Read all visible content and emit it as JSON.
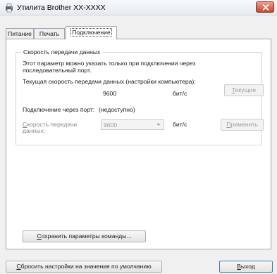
{
  "window": {
    "title": "Утилита Brother XX-XXXX"
  },
  "tabs": [
    {
      "label": "Питание"
    },
    {
      "label": "Печать"
    },
    {
      "label": "Подключение"
    }
  ],
  "connection": {
    "group_title": "Скорость передачи данных",
    "description_line1": "Этот параметр можно указать только при подключении через",
    "description_line2": "последовательный порт.",
    "current_speed_label": "Текущая скорость передачи данных (настройки компьютера):",
    "current_speed_value": "9600",
    "current_speed_unit": "бит/с",
    "current_button": {
      "first": "Т",
      "rest": "екущие"
    },
    "port_label": "Подключение через порт:",
    "port_value": "(недоступно)",
    "speed_label_first": "С",
    "speed_label_rest": "корость передачи",
    "speed_label_line2": "данных:",
    "speed_select_value": "9600",
    "speed_unit": "бит/с",
    "apply_button": {
      "first": "П",
      "rest": "рименить"
    }
  },
  "save_button": {
    "first": "С",
    "rest": "охранить параметры команды..."
  },
  "footer": {
    "reset_button": {
      "first": "С",
      "rest": "бросить настройки на значения по умолчанию"
    },
    "exit_button": {
      "first": "В",
      "rest": "ыход"
    }
  },
  "colors": {
    "close_button": "#c7452b",
    "title_gradient_top": "#f7f9fb",
    "panel_background": "#ffffff",
    "window_background": "#f0f0f0"
  }
}
